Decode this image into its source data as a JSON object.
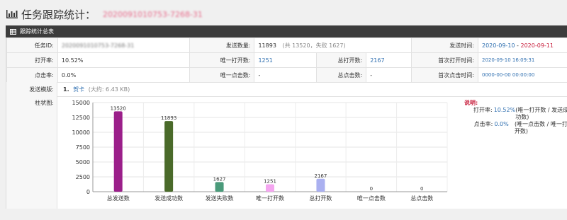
{
  "page": {
    "title": "任务跟踪统计：",
    "task_id_display": "2020091010753-7268-31"
  },
  "panel": {
    "title": "跟踪统计总表"
  },
  "info": {
    "task_id_label": "任务ID:",
    "task_id_value": "2020091010753-7268-31",
    "sent_count_label": "发送数量:",
    "sent_count_value": "11893",
    "sent_count_note": "(共 13520，失败 1627)",
    "send_time_label": "发送时间:",
    "send_time_start": "2020-09-10",
    "send_time_sep": " - ",
    "send_time_end": "2020-09-11",
    "open_rate_label": "打开率:",
    "open_rate_value": "10.52%",
    "unique_open_label": "唯一打开数:",
    "unique_open_value": "1251",
    "total_open_label": "总打开数:",
    "total_open_value": "2167",
    "first_open_label": "首次打开时间:",
    "first_open_value": "2020-09-10 16:09:31",
    "click_rate_label": "点击率:",
    "click_rate_value": "0.0%",
    "unique_click_label": "唯一点击数:",
    "unique_click_value": "-",
    "total_click_label": "总点击数:",
    "total_click_value": "-",
    "first_click_label": "首次点击时间:",
    "first_click_value": "0000-00-00 00:00:00",
    "template_label": "发送模版:",
    "template_index": "1.",
    "template_name": "贺卡",
    "template_size": "(大约: 6.43 KB)",
    "chart_label": "柱状图:"
  },
  "legend": {
    "title": "说明:",
    "rows": [
      {
        "k": "打开率:",
        "n": "10.52%",
        "d": "(唯一打开数 / 发送成功数)"
      },
      {
        "k": "点击率:",
        "n": "0.0%",
        "d": "(唯一点击数 / 唯一打开数)"
      }
    ]
  },
  "colors": {
    "bar_1": "#9b1f8a",
    "bar_2": "#4a6a2a",
    "bar_3": "#4a9a7a",
    "bar_4": "#f4a6f0",
    "bar_5": "#aab0f0",
    "bar_6": "#cccccc",
    "bar_7": "#cccccc",
    "value_blue": "#2f6fb0",
    "value_red": "#c81e3c"
  },
  "chart_data": {
    "type": "bar",
    "categories": [
      "总发送数",
      "发送成功数",
      "发送失败数",
      "唯一打开数",
      "总打开数",
      "唯一点击数",
      "总点击数"
    ],
    "values": [
      13520,
      11893,
      1627,
      1251,
      2167,
      0,
      0
    ],
    "value_labels": [
      "13520",
      "11893",
      "1627",
      "1251",
      "2167",
      "0",
      "0"
    ],
    "yticks": [
      0,
      2500,
      5000,
      7500,
      10000,
      12500,
      15000
    ],
    "ytick_labels": [
      "0",
      "2500",
      "5000",
      "7500",
      "10000",
      "12500",
      "15000"
    ],
    "ylim": [
      0,
      15000
    ],
    "grid": true,
    "title": "",
    "xlabel": "",
    "ylabel": ""
  }
}
